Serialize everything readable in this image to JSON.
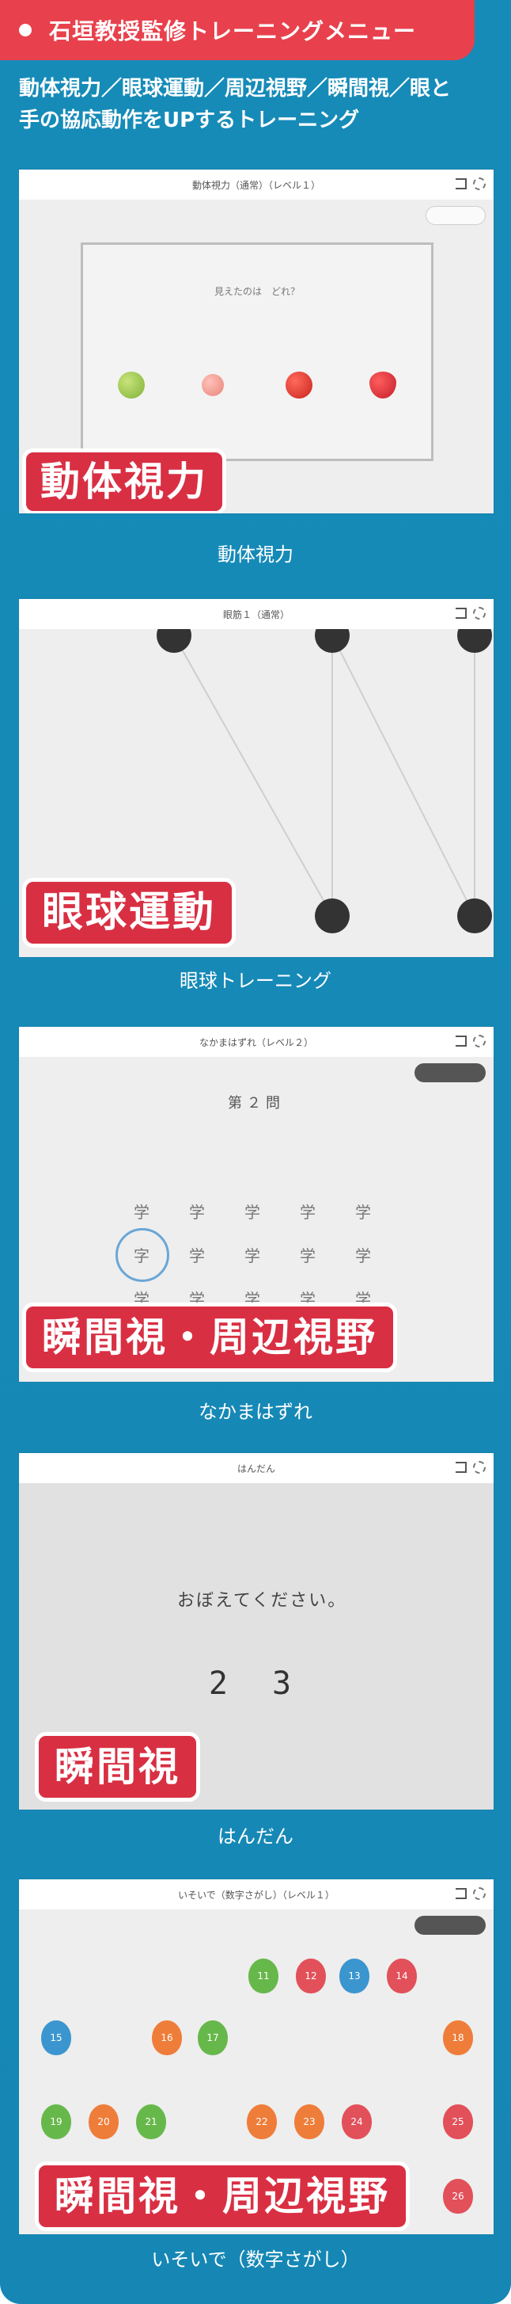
{
  "header": {
    "title": "石垣教授監修トレーニングメニュー"
  },
  "subtitle": "動体視力／眼球運動／周辺視野／瞬間視／眼と\n手の協応動作をUPするトレーニング",
  "sections": [
    {
      "badge": "動体視力",
      "caption": "動体視力",
      "topbar": "動体視力（通常）（レベル１）",
      "question": "見えたのは　どれ？",
      "fruits": [
        "melon",
        "peach",
        "apple",
        "strawberry"
      ]
    },
    {
      "badge": "眼球運動",
      "caption": "眼球トレーニング",
      "topbar": "眼筋１（通常）"
    },
    {
      "badge": "瞬間視・周辺視野",
      "caption": "なかまはずれ",
      "topbar": "なかまはずれ（レベル２）",
      "question": "第２問",
      "char": "学",
      "odd_char": "字"
    },
    {
      "badge": "瞬間視",
      "caption": "はんだん",
      "topbar": "はんだん",
      "prompt": "おぼえてください。",
      "number": "2 3"
    },
    {
      "badge": "瞬間視・周辺視野",
      "caption": "いそいで（数字さがし）",
      "topbar": "いそいで（数字さがし）（レベル１）",
      "balloons": [
        {
          "n": "11",
          "c": "#67b84b"
        },
        {
          "n": "12",
          "c": "#e2505a"
        },
        {
          "n": "13",
          "c": "#3b95cf"
        },
        {
          "n": "14",
          "c": "#e2505a"
        },
        {
          "n": "15",
          "c": "#3b95cf"
        },
        {
          "n": "16",
          "c": "#ef7d3a"
        },
        {
          "n": "17",
          "c": "#67b84b"
        },
        {
          "n": "18",
          "c": "#ef7d3a"
        },
        {
          "n": "19",
          "c": "#67b84b"
        },
        {
          "n": "20",
          "c": "#ef7d3a"
        },
        {
          "n": "21",
          "c": "#67b84b"
        },
        {
          "n": "22",
          "c": "#ef7d3a"
        },
        {
          "n": "23",
          "c": "#ef7d3a"
        },
        {
          "n": "24",
          "c": "#e2505a"
        },
        {
          "n": "25",
          "c": "#e2505a"
        },
        {
          "n": "26",
          "c": "#e2505a"
        }
      ]
    }
  ],
  "colors": {
    "page_bg": "#168bb8",
    "header_bg": "#e8414d",
    "badge_bg": "#d92f43"
  },
  "icons": {
    "bullet": "white-dot-icon",
    "fullscreen": "fullscreen-icon",
    "settings": "gear-icon"
  }
}
